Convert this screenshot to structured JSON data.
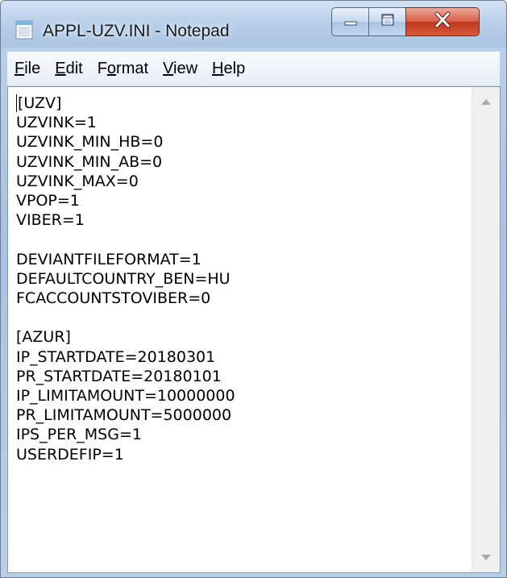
{
  "window": {
    "title": "APPL-UZV.INI - Notepad",
    "app_icon": "notepad-icon",
    "controls": {
      "minimize_icon": "minimize-icon",
      "maximize_icon": "maximize-icon",
      "close_icon": "close-icon"
    }
  },
  "menu": [
    {
      "before": "",
      "hot": "F",
      "after": "ile"
    },
    {
      "before": "",
      "hot": "E",
      "after": "dit"
    },
    {
      "before": "F",
      "hot": "o",
      "after": "rmat"
    },
    {
      "before": "",
      "hot": "V",
      "after": "iew"
    },
    {
      "before": "",
      "hot": "H",
      "after": "elp"
    }
  ],
  "editor": {
    "lines": [
      "[UZV]",
      "UZVINK=1",
      "UZVINK_MIN_HB=0",
      "UZVINK_MIN_AB=0",
      "UZVINK_MAX=0",
      "VPOP=1",
      "VIBER=1",
      "",
      "DEVIANTFILEFORMAT=1",
      "DEFAULTCOUNTRY_BEN=HU",
      "FCACCOUNTSTOVIBER=0",
      "",
      "[AZUR]",
      "IP_STARTDATE=20180301",
      "PR_STARTDATE=20180101",
      "IP_LIMITAMOUNT=10000000",
      "PR_LIMITAMOUNT=5000000",
      "IPS_PER_MSG=1",
      "USERDEFIP=1"
    ]
  },
  "colors": {
    "titlebar": "#bcd3ec",
    "close_button": "#c8442a",
    "editor_bg": "#ffffff"
  }
}
